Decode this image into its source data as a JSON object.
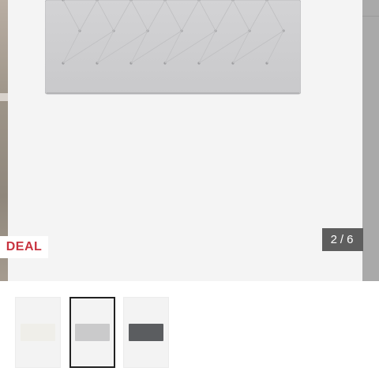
{
  "gallery": {
    "badge_label": "DEAL",
    "counter": {
      "current": "2",
      "separator": "/",
      "total": "6"
    },
    "headboard_color": "#cfcfd1",
    "thumbnails": [
      {
        "color": "#efeee9",
        "selected": false
      },
      {
        "color": "#cacacb",
        "selected": true
      },
      {
        "color": "#5b5d60",
        "selected": false
      }
    ]
  }
}
